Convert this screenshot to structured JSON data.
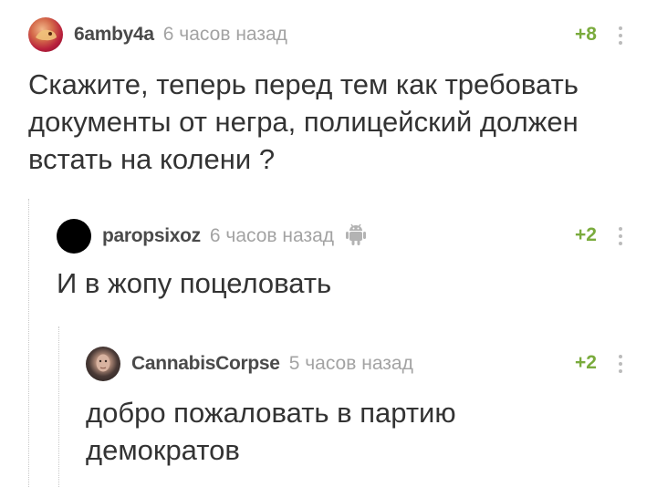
{
  "comments": [
    {
      "username": "6amby4a",
      "time": "6 часов назад",
      "rating": "+8",
      "text": "Скажите, теперь перед тем как требовать документы от негра, полицейский должен встать на колени ?"
    },
    {
      "username": "paropsixoz",
      "time": "6 часов назад",
      "rating": "+2",
      "platform_icon": "android-icon",
      "text": "И в жопу поцеловать"
    },
    {
      "username": "CannabisCorpse",
      "time": "5 часов назад",
      "rating": "+2",
      "text": "добро пожаловать в партию демократов"
    }
  ],
  "colors": {
    "rating": "#7aab3d",
    "username": "#4a4a4a",
    "time": "#a3a3a3",
    "text": "#333333"
  }
}
